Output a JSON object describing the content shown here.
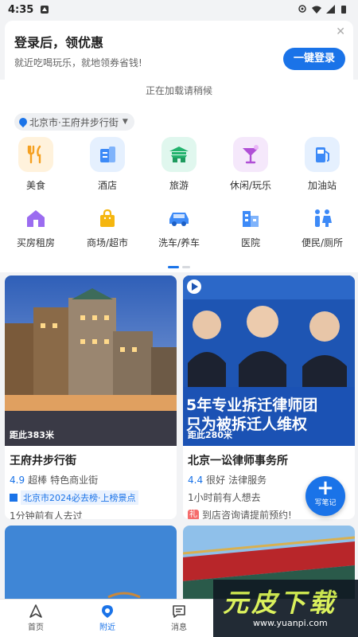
{
  "status_bar": {
    "time": "4:35"
  },
  "login_banner": {
    "title": "登录后，领优惠",
    "subtitle": "就近吃喝玩乐，就地领券省钱!",
    "button": "一键登录",
    "close_icon": "close-icon"
  },
  "loading_text": "正在加载请稍候",
  "location": "北京市·王府井步行街",
  "categories_row1": [
    {
      "label": "美食",
      "icon": "food-icon",
      "bg": "#fff2dc",
      "color": "#f5a020"
    },
    {
      "label": "酒店",
      "icon": "hotel-icon",
      "bg": "#e5f0fe",
      "color": "#3d8af7"
    },
    {
      "label": "旅游",
      "icon": "travel-icon",
      "bg": "#e0f7ee",
      "color": "#24b36e"
    },
    {
      "label": "休闲/玩乐",
      "icon": "leisure-icon",
      "bg": "#f5e8fb",
      "color": "#b04fd6"
    },
    {
      "label": "加油站",
      "icon": "gas-station-icon",
      "bg": "#e5f0fe",
      "color": "#3d8af7"
    }
  ],
  "categories_row2": [
    {
      "label": "买房租房",
      "icon": "house-icon",
      "color": "#9b6cf0"
    },
    {
      "label": "商场/超市",
      "icon": "shopping-bag-icon",
      "color": "#f5b60f"
    },
    {
      "label": "洗车/养车",
      "icon": "car-icon",
      "color": "#3d8af7"
    },
    {
      "label": "医院",
      "icon": "hospital-icon",
      "color": "#3d8af7"
    },
    {
      "label": "便民/厕所",
      "icon": "restroom-icon",
      "color": "#3d8af7"
    }
  ],
  "cards": [
    {
      "distance": "距此383米",
      "title": "王府井步行街",
      "rating": "4.9",
      "rating_text": "超棒",
      "category": "特色商业街",
      "rank_tag": "北京市2024必去榜·上榜景点",
      "activity": "1分钟前有人去过"
    },
    {
      "distance": "距此280米",
      "title": "北京一讼律师事务所",
      "rating": "4.4",
      "rating_text": "很好",
      "category": "法律服务",
      "activity": "1小时前有人想去",
      "gift_badge": "礼",
      "promo": "到店咨询请提前预约!",
      "banner_line1": "5年专业拆迁律师团",
      "banner_line2": "只为被拆迁人维权"
    }
  ],
  "fab_label": "写笔记",
  "tabs": [
    {
      "label": "首页",
      "icon": "navigate-icon",
      "active": false
    },
    {
      "label": "附近",
      "icon": "nearby-pin-icon",
      "active": true
    },
    {
      "label": "消息",
      "icon": "message-icon",
      "active": false
    }
  ],
  "watermark": {
    "text": "元皮下载",
    "url": "www.yuanpi.com"
  },
  "colors": {
    "accent": "#1a73e8",
    "background": "#f2f3f5"
  }
}
